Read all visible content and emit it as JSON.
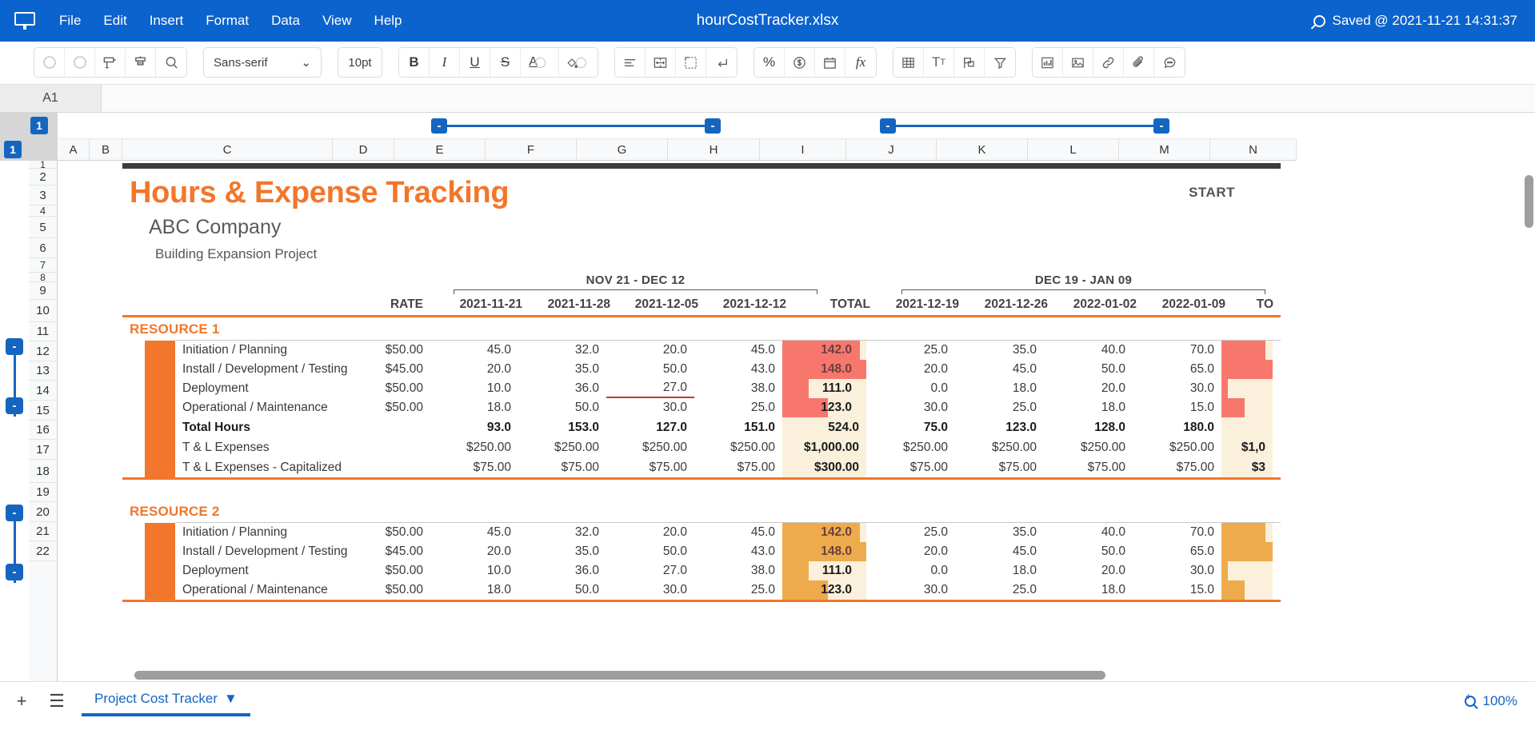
{
  "menubar": {
    "app_icon": "monitor-icon",
    "items": [
      "File",
      "Edit",
      "Insert",
      "Format",
      "Data",
      "View",
      "Help"
    ],
    "doc_title": "hourCostTracker.xlsx",
    "saved_status": "Saved @ 2021-11-21 14:31:37"
  },
  "toolbar": {
    "groups": [
      {
        "buttons": [
          {
            "name": "undo-icon",
            "glyph": "↺"
          },
          {
            "name": "redo-icon",
            "glyph": "↻"
          },
          {
            "name": "print-icon",
            "glyph": "print"
          },
          {
            "name": "paint-format-icon",
            "glyph": "brush"
          },
          {
            "name": "search-icon",
            "glyph": "Q"
          }
        ]
      },
      {
        "font_name": "Sans-serif",
        "font_size": "10pt"
      },
      {
        "buttons": [
          {
            "name": "bold-icon",
            "glyph": "B"
          },
          {
            "name": "italic-icon",
            "glyph": "I"
          },
          {
            "name": "underline-icon",
            "glyph": "U"
          },
          {
            "name": "strikethrough-icon",
            "glyph": "S"
          },
          {
            "name": "text-color-icon",
            "glyph": "A"
          },
          {
            "name": "fill-color-icon",
            "glyph": "fill"
          }
        ]
      },
      {
        "buttons": [
          {
            "name": "align-icon",
            "glyph": "align"
          },
          {
            "name": "merge-cells-icon",
            "glyph": "merge"
          },
          {
            "name": "borders-icon",
            "glyph": "borders"
          },
          {
            "name": "wrap-text-icon",
            "glyph": "wrap"
          }
        ]
      },
      {
        "buttons": [
          {
            "name": "percent-format-icon",
            "glyph": "%"
          },
          {
            "name": "currency-format-icon",
            "glyph": "$"
          },
          {
            "name": "date-format-icon",
            "glyph": "date"
          },
          {
            "name": "function-icon",
            "glyph": "fx"
          }
        ]
      },
      {
        "buttons": [
          {
            "name": "table-icon",
            "glyph": "table"
          },
          {
            "name": "text-size-icon",
            "glyph": "Tт"
          },
          {
            "name": "shape-icon",
            "glyph": "shape"
          },
          {
            "name": "filter-icon",
            "glyph": "funnel"
          }
        ]
      },
      {
        "buttons": [
          {
            "name": "chart-icon",
            "glyph": "chart"
          },
          {
            "name": "image-icon",
            "glyph": "image"
          },
          {
            "name": "link-icon",
            "glyph": "link"
          },
          {
            "name": "attachment-icon",
            "glyph": "clip"
          },
          {
            "name": "comment-icon",
            "glyph": "comment"
          }
        ]
      }
    ]
  },
  "namebar": {
    "cell_reference": "A1",
    "formula": ""
  },
  "grid": {
    "column_headers": [
      "A",
      "B",
      "C",
      "D",
      "E",
      "F",
      "G",
      "H",
      "I",
      "J",
      "K",
      "L",
      "M",
      "N"
    ],
    "row_numbers": [
      "1",
      "2",
      "3",
      "4",
      "5",
      "6",
      "7",
      "8",
      "9",
      "10",
      "11",
      "12",
      "13",
      "14",
      "15",
      "16",
      "17",
      "18",
      "19",
      "20",
      "21",
      "22"
    ],
    "outline_level_label": "1",
    "collapse_glyph": "-"
  },
  "sheet": {
    "title": "Hours & Expense Tracking",
    "company": "ABC Company",
    "project": "Building Expansion Project",
    "start_label": "START",
    "rate_label": "RATE",
    "total_label": "TOTAL",
    "total_label_truncated": "TO",
    "periods": [
      {
        "label": "NOV 21 - DEC 12",
        "dates": [
          "2021-11-21",
          "2021-11-28",
          "2021-12-05",
          "2021-12-12"
        ]
      },
      {
        "label": "DEC 19 - JAN 09",
        "dates": [
          "2021-12-19",
          "2021-12-26",
          "2022-01-02",
          "2022-01-09"
        ]
      }
    ],
    "resources": [
      {
        "name": "RESOURCE 1",
        "bar_color": "#f8776d",
        "bar_bg": "#faf0dc",
        "rows": [
          {
            "task": "Initiation / Planning",
            "rate": "$50.00",
            "p1": [
              "45.0",
              "32.0",
              "20.0",
              "45.0"
            ],
            "total1": "142.0",
            "total1_pct": 92,
            "p2": [
              "25.0",
              "35.0",
              "40.0",
              "70.0"
            ],
            "total2_pct": 86
          },
          {
            "task": "Install / Development / Testing",
            "rate": "$45.00",
            "p1": [
              "20.0",
              "35.0",
              "50.0",
              "43.0"
            ],
            "total1": "148.0",
            "total1_pct": 100,
            "p2": [
              "20.0",
              "45.0",
              "50.0",
              "65.0"
            ],
            "total2_pct": 100
          },
          {
            "task": "Deployment",
            "rate": "$50.00",
            "p1": [
              "10.0",
              "36.0",
              "27.0",
              "38.0"
            ],
            "total1": "111.0",
            "total1_pct": 31,
            "p2": [
              "0.0",
              "18.0",
              "20.0",
              "30.0"
            ],
            "total2_pct": 13
          },
          {
            "task": "Operational / Maintenance",
            "rate": "$50.00",
            "p1": [
              "18.0",
              "50.0",
              "30.0",
              "25.0"
            ],
            "total1": "123.0",
            "total1_pct": 54,
            "p2": [
              "30.0",
              "25.0",
              "18.0",
              "15.0"
            ],
            "total2_pct": 45
          }
        ],
        "total_hours": {
          "label": "Total Hours",
          "rate": "",
          "p1": [
            "93.0",
            "153.0",
            "127.0",
            "151.0"
          ],
          "total1": "524.0",
          "p2": [
            "75.0",
            "123.0",
            "128.0",
            "180.0"
          ]
        },
        "expenses": [
          {
            "task": "T & L Expenses",
            "rate": "",
            "p1": [
              "$250.00",
              "$250.00",
              "$250.00",
              "$250.00"
            ],
            "total1": "$1,000.00",
            "p2": [
              "$250.00",
              "$250.00",
              "$250.00",
              "$250.00"
            ],
            "total2": "$1,0"
          },
          {
            "task": "T & L Expenses - Capitalized",
            "rate": "",
            "p1": [
              "$75.00",
              "$75.00",
              "$75.00",
              "$75.00"
            ],
            "total1": "$300.00",
            "p2": [
              "$75.00",
              "$75.00",
              "$75.00",
              "$75.00"
            ],
            "total2": "$3"
          }
        ]
      },
      {
        "name": "RESOURCE 2",
        "bar_color": "#eeab4b",
        "bar_bg": "#faf0dc",
        "rows": [
          {
            "task": "Initiation / Planning",
            "rate": "$50.00",
            "p1": [
              "45.0",
              "32.0",
              "20.0",
              "45.0"
            ],
            "total1": "142.0",
            "total1_pct": 92,
            "p2": [
              "25.0",
              "35.0",
              "40.0",
              "70.0"
            ],
            "total2_pct": 86
          },
          {
            "task": "Install / Development / Testing",
            "rate": "$45.00",
            "p1": [
              "20.0",
              "35.0",
              "50.0",
              "43.0"
            ],
            "total1": "148.0",
            "total1_pct": 100,
            "p2": [
              "20.0",
              "45.0",
              "50.0",
              "65.0"
            ],
            "total2_pct": 100
          },
          {
            "task": "Deployment",
            "rate": "$50.00",
            "p1": [
              "10.0",
              "36.0",
              "27.0",
              "38.0"
            ],
            "total1": "111.0",
            "total1_pct": 31,
            "p2": [
              "0.0",
              "18.0",
              "20.0",
              "30.0"
            ],
            "total2_pct": 13
          },
          {
            "task": "Operational / Maintenance",
            "rate": "$50.00",
            "p1": [
              "18.0",
              "50.0",
              "30.0",
              "25.0"
            ],
            "total1": "123.0",
            "total1_pct": 54,
            "p2": [
              "30.0",
              "25.0",
              "18.0",
              "15.0"
            ],
            "total2_pct": 45
          }
        ]
      }
    ]
  },
  "bottombar": {
    "add_sheet": "+",
    "all_sheets": "☰",
    "sheet_tab": "Project Cost Tracker",
    "sheet_tab_caret": "▼",
    "zoom": "100%"
  }
}
